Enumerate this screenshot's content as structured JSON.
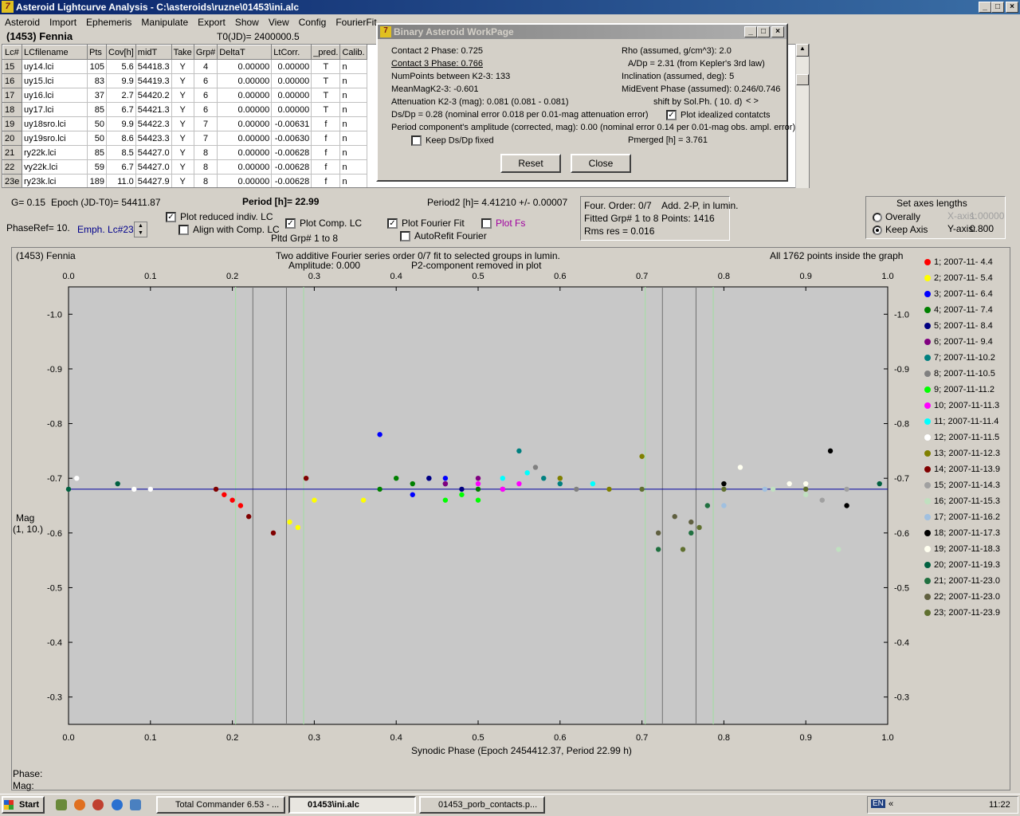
{
  "app": {
    "title": "Asteroid Lightcurve Analysis - C:\\asteroids\\ruzne\\01453\\ini.alc",
    "menu": [
      "Asteroid",
      "Import",
      "Ephemeris",
      "Manipulate",
      "Export",
      "Show",
      "View",
      "Config",
      "FourierFit"
    ],
    "asteroid_name": "(1453) Fennia",
    "t0": "T0(JD)= 2400000.5"
  },
  "table": {
    "columns": [
      "Lc#",
      "LCfilename",
      "Pts",
      "Cov[h]",
      "midT",
      "Take",
      "Grp#",
      "DeltaT",
      "LtCorr.",
      "_pred.",
      "Calib."
    ],
    "rows": [
      [
        "15",
        "uy14.lci",
        "105",
        "5.6",
        "54418.3",
        "Y",
        "4",
        "0.00000",
        "0.00000",
        "T",
        "n"
      ],
      [
        "16",
        "uy15.lci",
        "83",
        "9.9",
        "54419.3",
        "Y",
        "6",
        "0.00000",
        "0.00000",
        "T",
        "n"
      ],
      [
        "17",
        "uy16.lci",
        "37",
        "2.7",
        "54420.2",
        "Y",
        "6",
        "0.00000",
        "0.00000",
        "T",
        "n"
      ],
      [
        "18",
        "uy17.lci",
        "85",
        "6.7",
        "54421.3",
        "Y",
        "6",
        "0.00000",
        "0.00000",
        "T",
        "n"
      ],
      [
        "19",
        "uy18sro.lci",
        "50",
        "9.9",
        "54422.3",
        "Y",
        "7",
        "0.00000",
        "-0.00631",
        "f",
        "n"
      ],
      [
        "20",
        "uy19sro.lci",
        "50",
        "8.6",
        "54423.3",
        "Y",
        "7",
        "0.00000",
        "-0.00630",
        "f",
        "n"
      ],
      [
        "21",
        "ry22k.lci",
        "85",
        "8.5",
        "54427.0",
        "Y",
        "8",
        "0.00000",
        "-0.00628",
        "f",
        "n"
      ],
      [
        "22",
        "vy22k.lci",
        "59",
        "6.7",
        "54427.0",
        "Y",
        "8",
        "0.00000",
        "-0.00628",
        "f",
        "n"
      ],
      [
        "23e",
        "ry23k.lci",
        "189",
        "11.0",
        "54427.9",
        "Y",
        "8",
        "0.00000",
        "-0.00628",
        "f",
        "n"
      ]
    ]
  },
  "dialog": {
    "title": "Binary Asteroid WorkPage",
    "contact2": "Contact 2 Phase:   0.725",
    "contact3": "Contact 3 Phase:   0.766",
    "numpoints": "NumPoints between K2-3:    133",
    "meanmag": "MeanMagK2-3:  -0.601",
    "attenuation": "Attenuation K2-3 (mag):  0.081  (0.081 - 0.081)",
    "dsdp": "Ds/Dp = 0.28 (nominal error 0.018 per 0.01-mag attenuation error)",
    "period_amp": "Period component's amplitude (corrected, mag): 0.00 (nominal error 0.14 per 0.01-mag obs. ampl. error)",
    "keep_dsdp": "Keep Ds/Dp fixed",
    "rho": "Rho (assumed, g/cm^3): 2.0",
    "adp": "A/Dp = 2.31 (from Kepler's 3rd law)",
    "inclination": "Inclination (assumed, deg): 5",
    "midevent": "MidEvent Phase (assumed): 0.246/0.746",
    "shift": "shift by Sol.Ph. ( 10. d)",
    "shift_arrows": "< >",
    "plot_idealized": "Plot idealized contatcts",
    "pmerged": "Pmerged [h] =  3.761",
    "reset": "Reset",
    "close": "Close"
  },
  "controls": {
    "g": "G= 0.15",
    "epoch": "Epoch (JD-T0)= 54411.87",
    "period": "Period [h]= 22.99",
    "period2": "Period2 [h]= 4.41210 +/- 0.00007",
    "phaseref": "PhaseRef= 10.",
    "emph": "Emph. Lc#23:",
    "plot_reduced": "Plot reduced indiv. LC",
    "align": "Align with Comp. LC",
    "plot_comp": "Plot Comp. LC",
    "pltd": "Pltd Grp#  1   to    8",
    "plot_fourier": "Plot Fourier Fit",
    "autorefit": "AutoRefit Fourier",
    "plot_fs": "Plot Fs",
    "four_order": "Four. Order:  0/7",
    "add2p": "Add. 2-P, in lumin.",
    "fitted": "Fitted Grp# 1 to 8",
    "points": "Points: 1416",
    "rms": "Rms res      = 0.016",
    "axes_title": "Set axes lengths",
    "overally": "Overally",
    "keep_axis": "Keep Axis",
    "xaxis_label": "X-axis:",
    "xaxis_val": "1.00000",
    "yaxis_label": "Y-axis:",
    "yaxis_val": "0.800"
  },
  "plot": {
    "name": "(1453) Fennia",
    "subtitle1": "Two additive Fourier series order 0/7 fit to selected groups in lumin.",
    "subtitle2": "Amplitude: 0.000",
    "subtitle3": "P2-component removed in plot",
    "inside": "All 1762 points inside the graph",
    "ylabel1": "Mag",
    "ylabel2": "(1, 10.)",
    "xlabel": "Synodic Phase (Epoch 2454412.37, Period 22.99 h)",
    "phase_label": "Phase:",
    "mag_label": "Mag:"
  },
  "chart_data": {
    "type": "scatter",
    "xlim": [
      0.0,
      1.0
    ],
    "ylim": [
      -0.25,
      -1.05
    ],
    "xticks": [
      "0.0",
      "0.1",
      "0.2",
      "0.3",
      "0.4",
      "0.5",
      "0.6",
      "0.7",
      "0.8",
      "0.9",
      "1.0"
    ],
    "yticks": [
      "-1.0",
      "-0.9",
      "-0.8",
      "-0.7",
      "-0.6",
      "-0.5",
      "-0.4",
      "-0.3"
    ],
    "fit_line_y": -0.68,
    "vlines_gray": [
      0.225,
      0.266,
      0.725,
      0.766
    ],
    "vlines_green": [
      0.204,
      0.287,
      0.704,
      0.787
    ],
    "series": [
      {
        "name": "1; 2007-11- 4.4",
        "color": "#ff0000",
        "points": [
          [
            0.19,
            -0.67
          ],
          [
            0.2,
            -0.66
          ],
          [
            0.21,
            -0.65
          ]
        ]
      },
      {
        "name": "2; 2007-11- 5.4",
        "color": "#ffff00",
        "points": [
          [
            0.27,
            -0.62
          ],
          [
            0.28,
            -0.61
          ],
          [
            0.3,
            -0.66
          ],
          [
            0.36,
            -0.66
          ]
        ]
      },
      {
        "name": "3; 2007-11- 6.4",
        "color": "#0000ff",
        "points": [
          [
            0.38,
            -0.78
          ],
          [
            0.42,
            -0.67
          ],
          [
            0.44,
            -0.7
          ],
          [
            0.46,
            -0.7
          ]
        ]
      },
      {
        "name": "4; 2007-11- 7.4",
        "color": "#008000",
        "points": [
          [
            0.38,
            -0.68
          ],
          [
            0.4,
            -0.7
          ],
          [
            0.42,
            -0.69
          ],
          [
            0.5,
            -0.68
          ]
        ]
      },
      {
        "name": "5; 2007-11- 8.4",
        "color": "#000080",
        "points": [
          [
            0.44,
            -0.7
          ],
          [
            0.46,
            -0.69
          ],
          [
            0.48,
            -0.68
          ]
        ]
      },
      {
        "name": "6; 2007-11- 9.4",
        "color": "#800080",
        "points": [
          [
            0.46,
            -0.69
          ],
          [
            0.5,
            -0.7
          ],
          [
            0.53,
            -0.68
          ]
        ]
      },
      {
        "name": "7; 2007-11-10.2",
        "color": "#008080",
        "points": [
          [
            0.55,
            -0.75
          ],
          [
            0.58,
            -0.7
          ],
          [
            0.6,
            -0.69
          ]
        ]
      },
      {
        "name": "8; 2007-11-10.5",
        "color": "#808080",
        "points": [
          [
            0.57,
            -0.72
          ],
          [
            0.6,
            -0.7
          ],
          [
            0.62,
            -0.68
          ]
        ]
      },
      {
        "name": "9; 2007-11-11.2",
        "color": "#00ff00",
        "points": [
          [
            0.46,
            -0.66
          ],
          [
            0.48,
            -0.67
          ],
          [
            0.5,
            -0.66
          ]
        ]
      },
      {
        "name": "10; 2007-11-11.3",
        "color": "#ff00ff",
        "points": [
          [
            0.5,
            -0.69
          ],
          [
            0.53,
            -0.68
          ],
          [
            0.55,
            -0.69
          ]
        ]
      },
      {
        "name": "11; 2007-11-11.4",
        "color": "#00ffff",
        "points": [
          [
            0.53,
            -0.7
          ],
          [
            0.56,
            -0.71
          ],
          [
            0.64,
            -0.69
          ]
        ]
      },
      {
        "name": "12; 2007-11-11.5",
        "color": "#ffffff",
        "points": [
          [
            0.01,
            -0.7
          ],
          [
            0.08,
            -0.68
          ],
          [
            0.1,
            -0.68
          ]
        ]
      },
      {
        "name": "13; 2007-11-12.3",
        "color": "#808000",
        "points": [
          [
            0.6,
            -0.7
          ],
          [
            0.66,
            -0.68
          ],
          [
            0.7,
            -0.74
          ]
        ]
      },
      {
        "name": "14; 2007-11-13.9",
        "color": "#800000",
        "points": [
          [
            0.18,
            -0.68
          ],
          [
            0.22,
            -0.63
          ],
          [
            0.25,
            -0.6
          ],
          [
            0.29,
            -0.7
          ]
        ]
      },
      {
        "name": "15; 2007-11-14.3",
        "color": "#a0a0a0",
        "points": [
          [
            0.95,
            -0.68
          ],
          [
            0.92,
            -0.66
          ]
        ]
      },
      {
        "name": "16; 2007-11-15.3",
        "color": "#c0e0c0",
        "points": [
          [
            0.86,
            -0.68
          ],
          [
            0.9,
            -0.67
          ],
          [
            0.94,
            -0.57
          ]
        ]
      },
      {
        "name": "17; 2007-11-16.2",
        "color": "#a0c0e0",
        "points": [
          [
            0.8,
            -0.65
          ],
          [
            0.85,
            -0.68
          ]
        ]
      },
      {
        "name": "18; 2007-11-17.3",
        "color": "#000000",
        "points": [
          [
            0.8,
            -0.69
          ],
          [
            0.93,
            -0.75
          ],
          [
            0.95,
            -0.65
          ]
        ]
      },
      {
        "name": "19; 2007-11-18.3",
        "color": "#fffff0",
        "points": [
          [
            0.82,
            -0.72
          ],
          [
            0.88,
            -0.69
          ],
          [
            0.9,
            -0.69
          ]
        ]
      },
      {
        "name": "20; 2007-11-19.3",
        "color": "#006040",
        "points": [
          [
            0.0,
            -0.68
          ],
          [
            0.06,
            -0.69
          ],
          [
            0.99,
            -0.69
          ]
        ]
      },
      {
        "name": "21; 2007-11-23.0",
        "color": "#207040",
        "points": [
          [
            0.72,
            -0.57
          ],
          [
            0.76,
            -0.6
          ],
          [
            0.78,
            -0.65
          ]
        ]
      },
      {
        "name": "22; 2007-11-23.0",
        "color": "#606040",
        "points": [
          [
            0.72,
            -0.6
          ],
          [
            0.74,
            -0.63
          ],
          [
            0.76,
            -0.62
          ]
        ]
      },
      {
        "name": "23; 2007-11-23.9",
        "color": "#607030",
        "points": [
          [
            0.7,
            -0.68
          ],
          [
            0.75,
            -0.57
          ],
          [
            0.77,
            -0.61
          ],
          [
            0.8,
            -0.68
          ],
          [
            0.9,
            -0.68
          ]
        ]
      }
    ]
  },
  "taskbar": {
    "start": "Start",
    "item1": "Total Commander 6.53 - ...",
    "item2": "01453\\ini.alc",
    "item3": "01453_porb_contacts.p...",
    "lang": "EN",
    "clock": "11:22"
  }
}
